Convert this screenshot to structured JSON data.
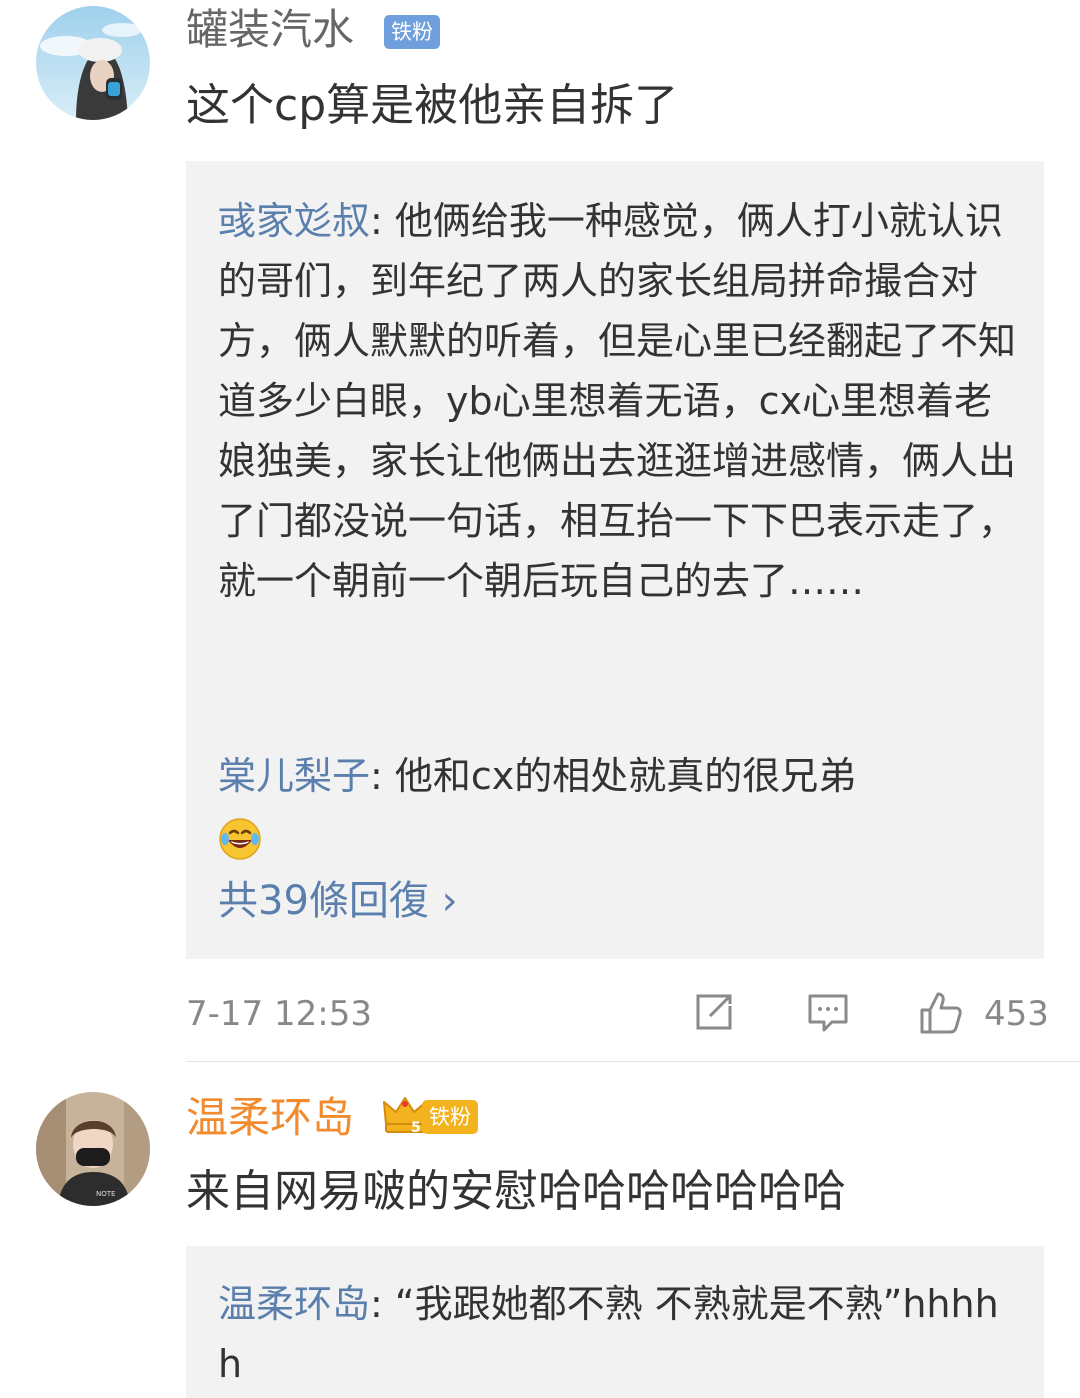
{
  "comments": [
    {
      "username": "罐装汽水",
      "badge": "铁粉",
      "text": "这个cp算是被他亲自拆了",
      "replies": [
        {
          "name": "彧家彣叔",
          "text": ": 他俩给我一种感觉，俩人打小就认识的哥们，到年纪了两人的家长组局拼命撮合对方，俩人默默的听着，但是心里已经翻起了不知道多少白眼，yb心里想着无语，cx心里想着老娘独美，家长让他俩出去逛逛增进感情，俩人出了门都没说一句话，相互抬一下下巴表示走了，就一个朝前一个朝后玩自己的去了……"
        },
        {
          "name": "棠儿梨子",
          "text": ": 他和cx的相处就真的很兄弟",
          "emoji": "laughing-crying-emoji"
        }
      ],
      "more_replies": "共39條回復 ›",
      "time": "7-17 12:53",
      "likes": "453"
    },
    {
      "username": "温柔环岛",
      "badge": "铁粉",
      "badge_level": "5",
      "text": "来自网易啵的安慰哈哈哈哈哈哈哈",
      "replies": [
        {
          "name": "温柔环岛",
          "text": ": “我跟她都不熟 不熟就是不熟”hhhhh"
        }
      ]
    }
  ],
  "colors": {
    "name_default": "#666666",
    "name_vip": "#f28a2e",
    "badge_blue": "#6f9fdc",
    "badge_gold": "#f3b31e",
    "reply_name": "#5b7fad",
    "reply_bg": "#f2f2f2",
    "meta": "#888888"
  },
  "icons": [
    "repost-icon",
    "comment-icon",
    "like-icon",
    "crown-icon"
  ]
}
